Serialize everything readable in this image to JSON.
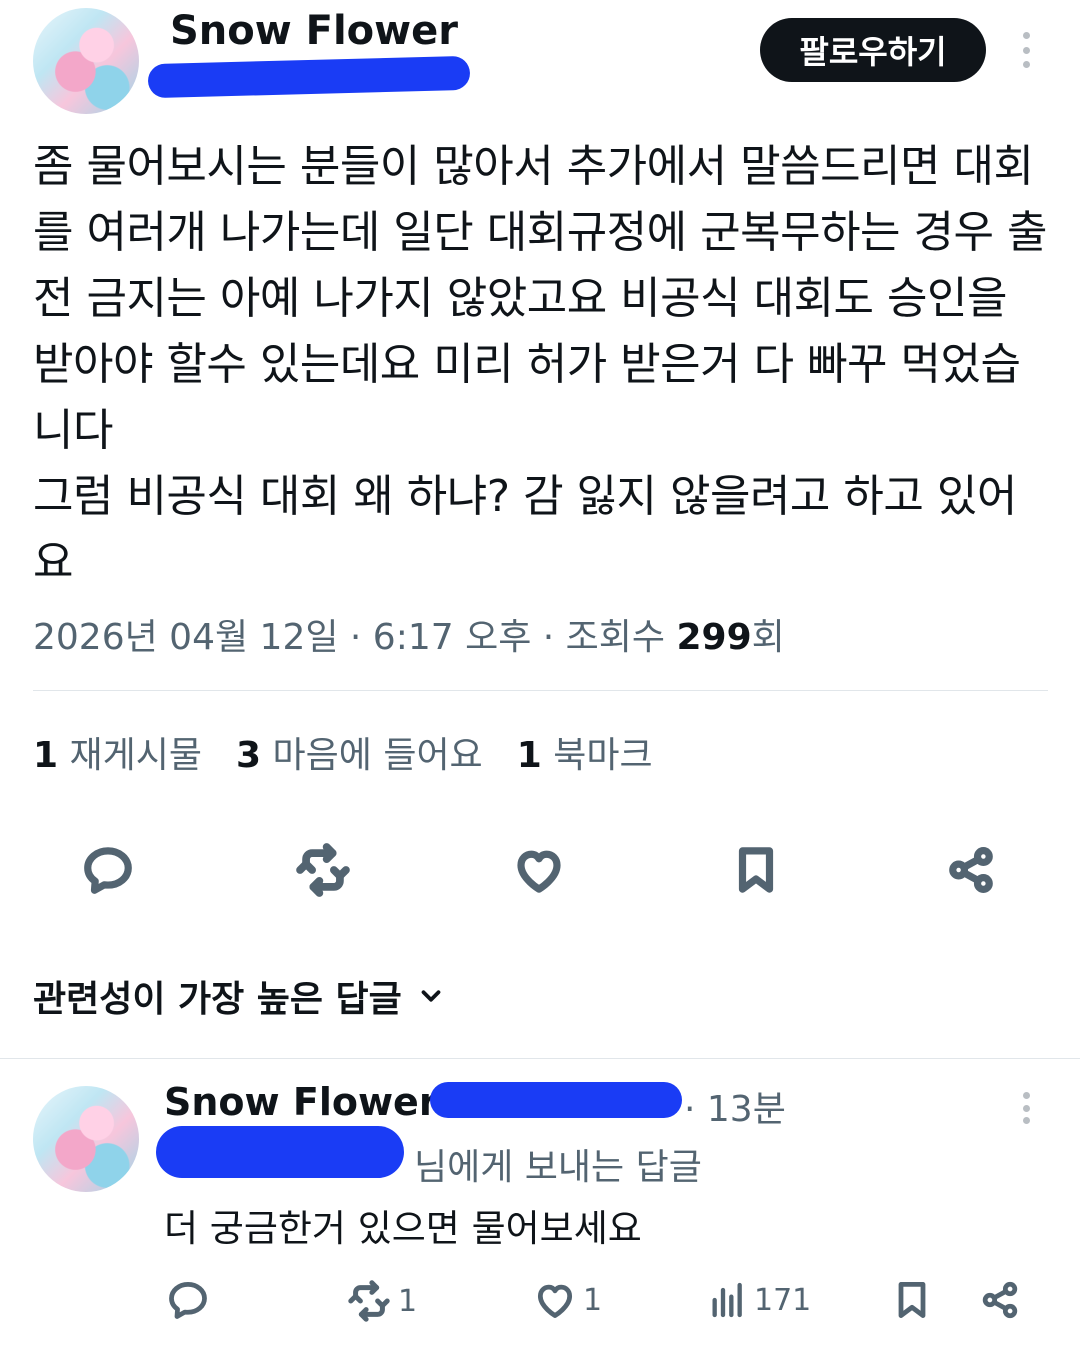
{
  "tweet": {
    "author_name": "Snow Flower",
    "follow_label": "팔로우하기",
    "text": "좀 물어보시는 분들이 많아서 추가에서 말씀드리면 대회를 여러개 나가는데 일단 대회규정에 군복무하는 경우 출전 금지는 아예 나가지 않았고요 비공식 대회도 승인을 받아야 할수 있는데요 미리 허가 받은거 다 빠꾸 먹었습니다\n그럼 비공식 대회 왜 하냐? 감 잃지 않을려고 하고 있어요",
    "timestamp": "2026년 04월 12일 · 6:17 오후 · 조회수 ",
    "views": "299",
    "views_suffix": "회"
  },
  "stats": {
    "retweets_count": "1",
    "retweets_label": "재게시물",
    "likes_count": "3",
    "likes_label": "마음에 들어요",
    "bookmarks_count": "1",
    "bookmarks_label": "북마크"
  },
  "actions": [
    "reply-icon",
    "retweet-icon",
    "heart-icon",
    "bookmark-icon",
    "share-icon"
  ],
  "replies_sort": {
    "label": "관련성이 가장 높은 답글"
  },
  "reply": {
    "author_name": "Snow Flower",
    "time": "· 13분",
    "replying_to_suffix": "님에게 보내는 답글",
    "text": "더 궁금한거 있으면 물어보세요",
    "retweet_count": "1",
    "like_count": "1",
    "view_count": "171"
  },
  "colors": {
    "redaction": "#1a3cf5",
    "secondary_text": "#536471",
    "primary_text": "#0f1419"
  }
}
